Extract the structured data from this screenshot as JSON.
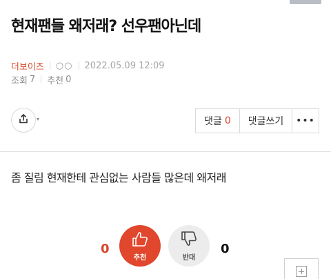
{
  "post": {
    "title": "현재팬들 왜저래? 선우팬아닌데",
    "author": "더보이즈",
    "level_marks": "○○",
    "date": "2022.05.09 12:09",
    "views_label": "조회",
    "views_value": "7",
    "recommend_label": "추천",
    "recommend_value": "0",
    "body": "좀 질림 현재한테 관심없는 사람들 많은데 왜저래"
  },
  "actions": {
    "comments_label": "댓글",
    "comments_count": "0",
    "write_comment_label": "댓글쓰기",
    "more_label": "•••"
  },
  "votes": {
    "recommend_count": "0",
    "recommend_label": "추천",
    "oppose_count": "0",
    "oppose_label": "반대"
  },
  "colors": {
    "accent": "#d9472b",
    "recommend_bg": "#e0472d",
    "oppose_bg": "#ececec"
  },
  "icons": {
    "share": "share-icon",
    "thumbs_up": "thumbs-up-icon",
    "thumbs_down": "thumbs-down-icon",
    "add": "plus-box-icon"
  }
}
